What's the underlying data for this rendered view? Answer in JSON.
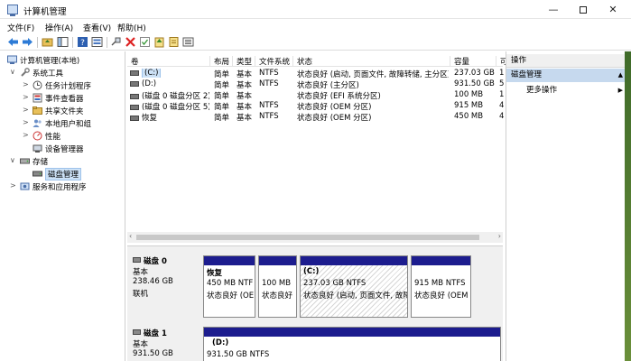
{
  "window": {
    "title": "计算机管理",
    "controls": {
      "minimize": "—",
      "maximize": "",
      "close": "✕"
    }
  },
  "menu": [
    "文件(F)",
    "操作(A)",
    "查看(V)",
    "帮助(H)"
  ],
  "tree": {
    "items": [
      {
        "label": "计算机管理(本地)",
        "level": 0,
        "twisty": "",
        "icon": "computer-management-icon"
      },
      {
        "label": "系统工具",
        "level": 1,
        "twisty": "∨",
        "icon": "tools-icon"
      },
      {
        "label": "任务计划程序",
        "level": 2,
        "twisty": ">",
        "icon": "clock-icon"
      },
      {
        "label": "事件查看器",
        "level": 2,
        "twisty": ">",
        "icon": "event-viewer-icon"
      },
      {
        "label": "共享文件夹",
        "level": 2,
        "twisty": ">",
        "icon": "shared-folder-icon"
      },
      {
        "label": "本地用户和组",
        "level": 2,
        "twisty": ">",
        "icon": "users-icon"
      },
      {
        "label": "性能",
        "level": 2,
        "twisty": ">",
        "icon": "performance-icon"
      },
      {
        "label": "设备管理器",
        "level": 2,
        "twisty": "",
        "icon": "device-manager-icon"
      },
      {
        "label": "存储",
        "level": 1,
        "twisty": "∨",
        "icon": "storage-icon"
      },
      {
        "label": "磁盘管理",
        "level": 2,
        "twisty": "",
        "icon": "disk-management-icon",
        "selected": true
      },
      {
        "label": "服务和应用程序",
        "level": 1,
        "twisty": ">",
        "icon": "services-icon"
      }
    ]
  },
  "volumes": {
    "columns": [
      "卷",
      "布局",
      "类型",
      "文件系统",
      "状态",
      "容量",
      "可"
    ],
    "rows": [
      {
        "name": "(C:)",
        "layout": "简单",
        "type": "基本",
        "fs": "NTFS",
        "status": "状态良好 (启动, 页面文件, 故障转储, 主分区)",
        "capacity": "237.03 GB",
        "free": "1"
      },
      {
        "name": "(D:)",
        "layout": "简单",
        "type": "基本",
        "fs": "NTFS",
        "status": "状态良好 (主分区)",
        "capacity": "931.50 GB",
        "free": "5"
      },
      {
        "name": "(磁盘 0 磁盘分区 2)",
        "layout": "简单",
        "type": "基本",
        "fs": "",
        "status": "状态良好 (EFI 系统分区)",
        "capacity": "100 MB",
        "free": "1"
      },
      {
        "name": "(磁盘 0 磁盘分区 5)",
        "layout": "简单",
        "type": "基本",
        "fs": "NTFS",
        "status": "状态良好 (OEM 分区)",
        "capacity": "915 MB",
        "free": "4"
      },
      {
        "name": "恢复",
        "layout": "简单",
        "type": "基本",
        "fs": "NTFS",
        "status": "状态良好 (OEM 分区)",
        "capacity": "450 MB",
        "free": "4"
      }
    ]
  },
  "disks": [
    {
      "name": "磁盘 0",
      "kind": "基本",
      "size": "238.46 GB",
      "state": "联机",
      "partitions": [
        {
          "title": "恢复",
          "size": "450 MB NTF",
          "status": "状态良好 (OE"
        },
        {
          "title": "",
          "size": "100 MB",
          "status": "状态良好"
        },
        {
          "title": "(C:)",
          "size": "237.03 GB NTFS",
          "status": "状态良好 (启动, 页面文件, 故降"
        },
        {
          "title": "",
          "size": "915 MB NTFS",
          "status": "状态良好 (OEM"
        }
      ]
    },
    {
      "name": "磁盘 1",
      "kind": "基本",
      "size": "931.50 GB",
      "state": "",
      "partitions": [
        {
          "title": "(D:)",
          "size": "931.50 GB NTFS",
          "status": ""
        }
      ]
    }
  ],
  "actions": {
    "header": "操作",
    "section": "磁盘管理",
    "more": "更多操作"
  },
  "colors": {
    "partition_bar": "#1c1c8e",
    "selection": "#cde2f7",
    "action_section": "#c6d9ee"
  }
}
